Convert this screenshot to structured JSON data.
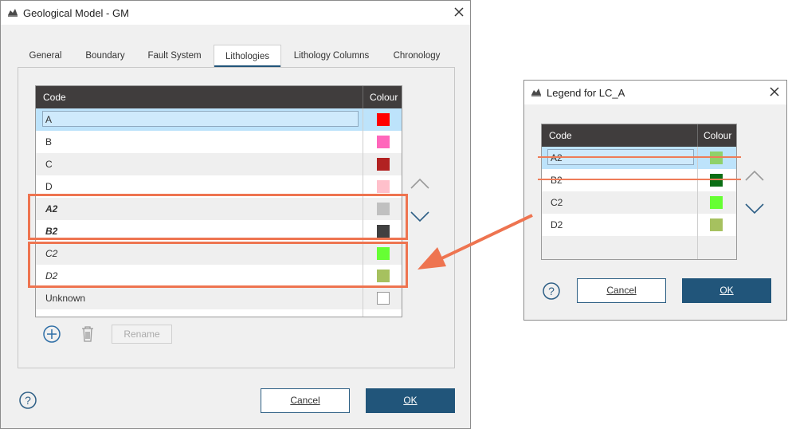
{
  "main_dialog": {
    "title": "Geological Model - GM",
    "tabs": [
      {
        "label": "General"
      },
      {
        "label": "Boundary"
      },
      {
        "label": "Fault System"
      },
      {
        "label": "Lithologies",
        "active": true
      },
      {
        "label": "Lithology Columns"
      },
      {
        "label": "Chronology"
      }
    ],
    "table": {
      "headers": {
        "code": "Code",
        "colour": "Colour"
      },
      "rows": [
        {
          "code": "A",
          "color": "#ff0000",
          "selected": true,
          "style": "normal"
        },
        {
          "code": "B",
          "color": "#ff66bb",
          "style": "normal"
        },
        {
          "code": "C",
          "color": "#b22222",
          "style": "normal"
        },
        {
          "code": "D",
          "color": "#ffc0cb",
          "style": "normal"
        },
        {
          "code": "A2",
          "color": "#c0c0c0",
          "style": "bold-italic"
        },
        {
          "code": "B2",
          "color": "#404040",
          "style": "bold-italic"
        },
        {
          "code": "C2",
          "color": "#66ff33",
          "style": "italic"
        },
        {
          "code": "D2",
          "color": "#a6c15f",
          "style": "italic"
        },
        {
          "code": "Unknown",
          "color": "#ffffff",
          "style": "normal"
        }
      ]
    },
    "toolbar": {
      "rename_label": "Rename"
    },
    "buttons": {
      "cancel": "Cancel",
      "ok": "OK"
    }
  },
  "legend_dialog": {
    "title": "Legend for LC_A",
    "table": {
      "headers": {
        "code": "Code",
        "colour": "Colour"
      },
      "rows": [
        {
          "code": "A2",
          "color": "#8fd16a",
          "selected": true,
          "struck": true
        },
        {
          "code": "B2",
          "color": "#0a6e14",
          "struck": true
        },
        {
          "code": "C2",
          "color": "#66ff33"
        },
        {
          "code": "D2",
          "color": "#a6c15f"
        }
      ]
    },
    "buttons": {
      "cancel": "Cancel",
      "ok": "OK"
    }
  },
  "colors": {
    "accent": "#21557a",
    "header_bg": "#403d3d",
    "selection": "#bde3fb",
    "highlight_orange": "#ee7450"
  }
}
